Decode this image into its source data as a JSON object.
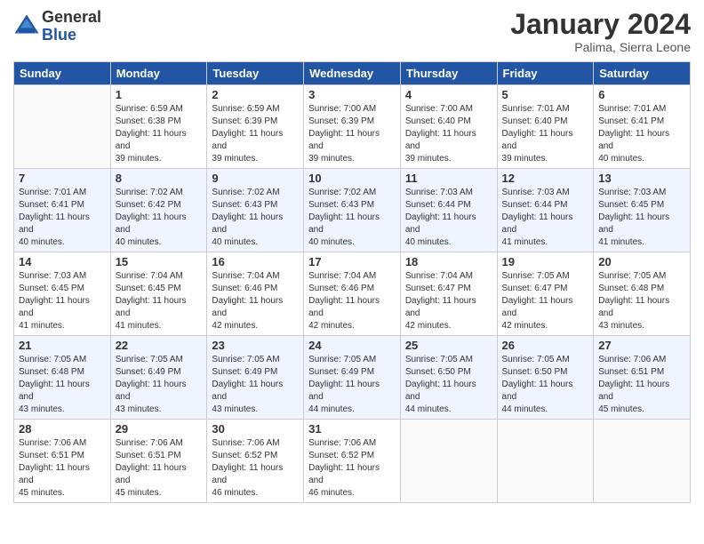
{
  "logo": {
    "general": "General",
    "blue": "Blue"
  },
  "title": "January 2024",
  "location": "Palima, Sierra Leone",
  "days_of_week": [
    "Sunday",
    "Monday",
    "Tuesday",
    "Wednesday",
    "Thursday",
    "Friday",
    "Saturday"
  ],
  "weeks": [
    [
      {
        "day": "",
        "sunrise": "",
        "sunset": "",
        "daylight": "",
        "empty": true
      },
      {
        "day": "1",
        "sunrise": "Sunrise: 6:59 AM",
        "sunset": "Sunset: 6:38 PM",
        "daylight": "Daylight: 11 hours and 39 minutes."
      },
      {
        "day": "2",
        "sunrise": "Sunrise: 6:59 AM",
        "sunset": "Sunset: 6:39 PM",
        "daylight": "Daylight: 11 hours and 39 minutes."
      },
      {
        "day": "3",
        "sunrise": "Sunrise: 7:00 AM",
        "sunset": "Sunset: 6:39 PM",
        "daylight": "Daylight: 11 hours and 39 minutes."
      },
      {
        "day": "4",
        "sunrise": "Sunrise: 7:00 AM",
        "sunset": "Sunset: 6:40 PM",
        "daylight": "Daylight: 11 hours and 39 minutes."
      },
      {
        "day": "5",
        "sunrise": "Sunrise: 7:01 AM",
        "sunset": "Sunset: 6:40 PM",
        "daylight": "Daylight: 11 hours and 39 minutes."
      },
      {
        "day": "6",
        "sunrise": "Sunrise: 7:01 AM",
        "sunset": "Sunset: 6:41 PM",
        "daylight": "Daylight: 11 hours and 40 minutes."
      }
    ],
    [
      {
        "day": "7",
        "sunrise": "Sunrise: 7:01 AM",
        "sunset": "Sunset: 6:41 PM",
        "daylight": "Daylight: 11 hours and 40 minutes."
      },
      {
        "day": "8",
        "sunrise": "Sunrise: 7:02 AM",
        "sunset": "Sunset: 6:42 PM",
        "daylight": "Daylight: 11 hours and 40 minutes."
      },
      {
        "day": "9",
        "sunrise": "Sunrise: 7:02 AM",
        "sunset": "Sunset: 6:43 PM",
        "daylight": "Daylight: 11 hours and 40 minutes."
      },
      {
        "day": "10",
        "sunrise": "Sunrise: 7:02 AM",
        "sunset": "Sunset: 6:43 PM",
        "daylight": "Daylight: 11 hours and 40 minutes."
      },
      {
        "day": "11",
        "sunrise": "Sunrise: 7:03 AM",
        "sunset": "Sunset: 6:44 PM",
        "daylight": "Daylight: 11 hours and 40 minutes."
      },
      {
        "day": "12",
        "sunrise": "Sunrise: 7:03 AM",
        "sunset": "Sunset: 6:44 PM",
        "daylight": "Daylight: 11 hours and 41 minutes."
      },
      {
        "day": "13",
        "sunrise": "Sunrise: 7:03 AM",
        "sunset": "Sunset: 6:45 PM",
        "daylight": "Daylight: 11 hours and 41 minutes."
      }
    ],
    [
      {
        "day": "14",
        "sunrise": "Sunrise: 7:03 AM",
        "sunset": "Sunset: 6:45 PM",
        "daylight": "Daylight: 11 hours and 41 minutes."
      },
      {
        "day": "15",
        "sunrise": "Sunrise: 7:04 AM",
        "sunset": "Sunset: 6:45 PM",
        "daylight": "Daylight: 11 hours and 41 minutes."
      },
      {
        "day": "16",
        "sunrise": "Sunrise: 7:04 AM",
        "sunset": "Sunset: 6:46 PM",
        "daylight": "Daylight: 11 hours and 42 minutes."
      },
      {
        "day": "17",
        "sunrise": "Sunrise: 7:04 AM",
        "sunset": "Sunset: 6:46 PM",
        "daylight": "Daylight: 11 hours and 42 minutes."
      },
      {
        "day": "18",
        "sunrise": "Sunrise: 7:04 AM",
        "sunset": "Sunset: 6:47 PM",
        "daylight": "Daylight: 11 hours and 42 minutes."
      },
      {
        "day": "19",
        "sunrise": "Sunrise: 7:05 AM",
        "sunset": "Sunset: 6:47 PM",
        "daylight": "Daylight: 11 hours and 42 minutes."
      },
      {
        "day": "20",
        "sunrise": "Sunrise: 7:05 AM",
        "sunset": "Sunset: 6:48 PM",
        "daylight": "Daylight: 11 hours and 43 minutes."
      }
    ],
    [
      {
        "day": "21",
        "sunrise": "Sunrise: 7:05 AM",
        "sunset": "Sunset: 6:48 PM",
        "daylight": "Daylight: 11 hours and 43 minutes."
      },
      {
        "day": "22",
        "sunrise": "Sunrise: 7:05 AM",
        "sunset": "Sunset: 6:49 PM",
        "daylight": "Daylight: 11 hours and 43 minutes."
      },
      {
        "day": "23",
        "sunrise": "Sunrise: 7:05 AM",
        "sunset": "Sunset: 6:49 PM",
        "daylight": "Daylight: 11 hours and 43 minutes."
      },
      {
        "day": "24",
        "sunrise": "Sunrise: 7:05 AM",
        "sunset": "Sunset: 6:49 PM",
        "daylight": "Daylight: 11 hours and 44 minutes."
      },
      {
        "day": "25",
        "sunrise": "Sunrise: 7:05 AM",
        "sunset": "Sunset: 6:50 PM",
        "daylight": "Daylight: 11 hours and 44 minutes."
      },
      {
        "day": "26",
        "sunrise": "Sunrise: 7:05 AM",
        "sunset": "Sunset: 6:50 PM",
        "daylight": "Daylight: 11 hours and 44 minutes."
      },
      {
        "day": "27",
        "sunrise": "Sunrise: 7:06 AM",
        "sunset": "Sunset: 6:51 PM",
        "daylight": "Daylight: 11 hours and 45 minutes."
      }
    ],
    [
      {
        "day": "28",
        "sunrise": "Sunrise: 7:06 AM",
        "sunset": "Sunset: 6:51 PM",
        "daylight": "Daylight: 11 hours and 45 minutes."
      },
      {
        "day": "29",
        "sunrise": "Sunrise: 7:06 AM",
        "sunset": "Sunset: 6:51 PM",
        "daylight": "Daylight: 11 hours and 45 minutes."
      },
      {
        "day": "30",
        "sunrise": "Sunrise: 7:06 AM",
        "sunset": "Sunset: 6:52 PM",
        "daylight": "Daylight: 11 hours and 46 minutes."
      },
      {
        "day": "31",
        "sunrise": "Sunrise: 7:06 AM",
        "sunset": "Sunset: 6:52 PM",
        "daylight": "Daylight: 11 hours and 46 minutes."
      },
      {
        "day": "",
        "sunrise": "",
        "sunset": "",
        "daylight": "",
        "empty": true
      },
      {
        "day": "",
        "sunrise": "",
        "sunset": "",
        "daylight": "",
        "empty": true
      },
      {
        "day": "",
        "sunrise": "",
        "sunset": "",
        "daylight": "",
        "empty": true
      }
    ]
  ]
}
